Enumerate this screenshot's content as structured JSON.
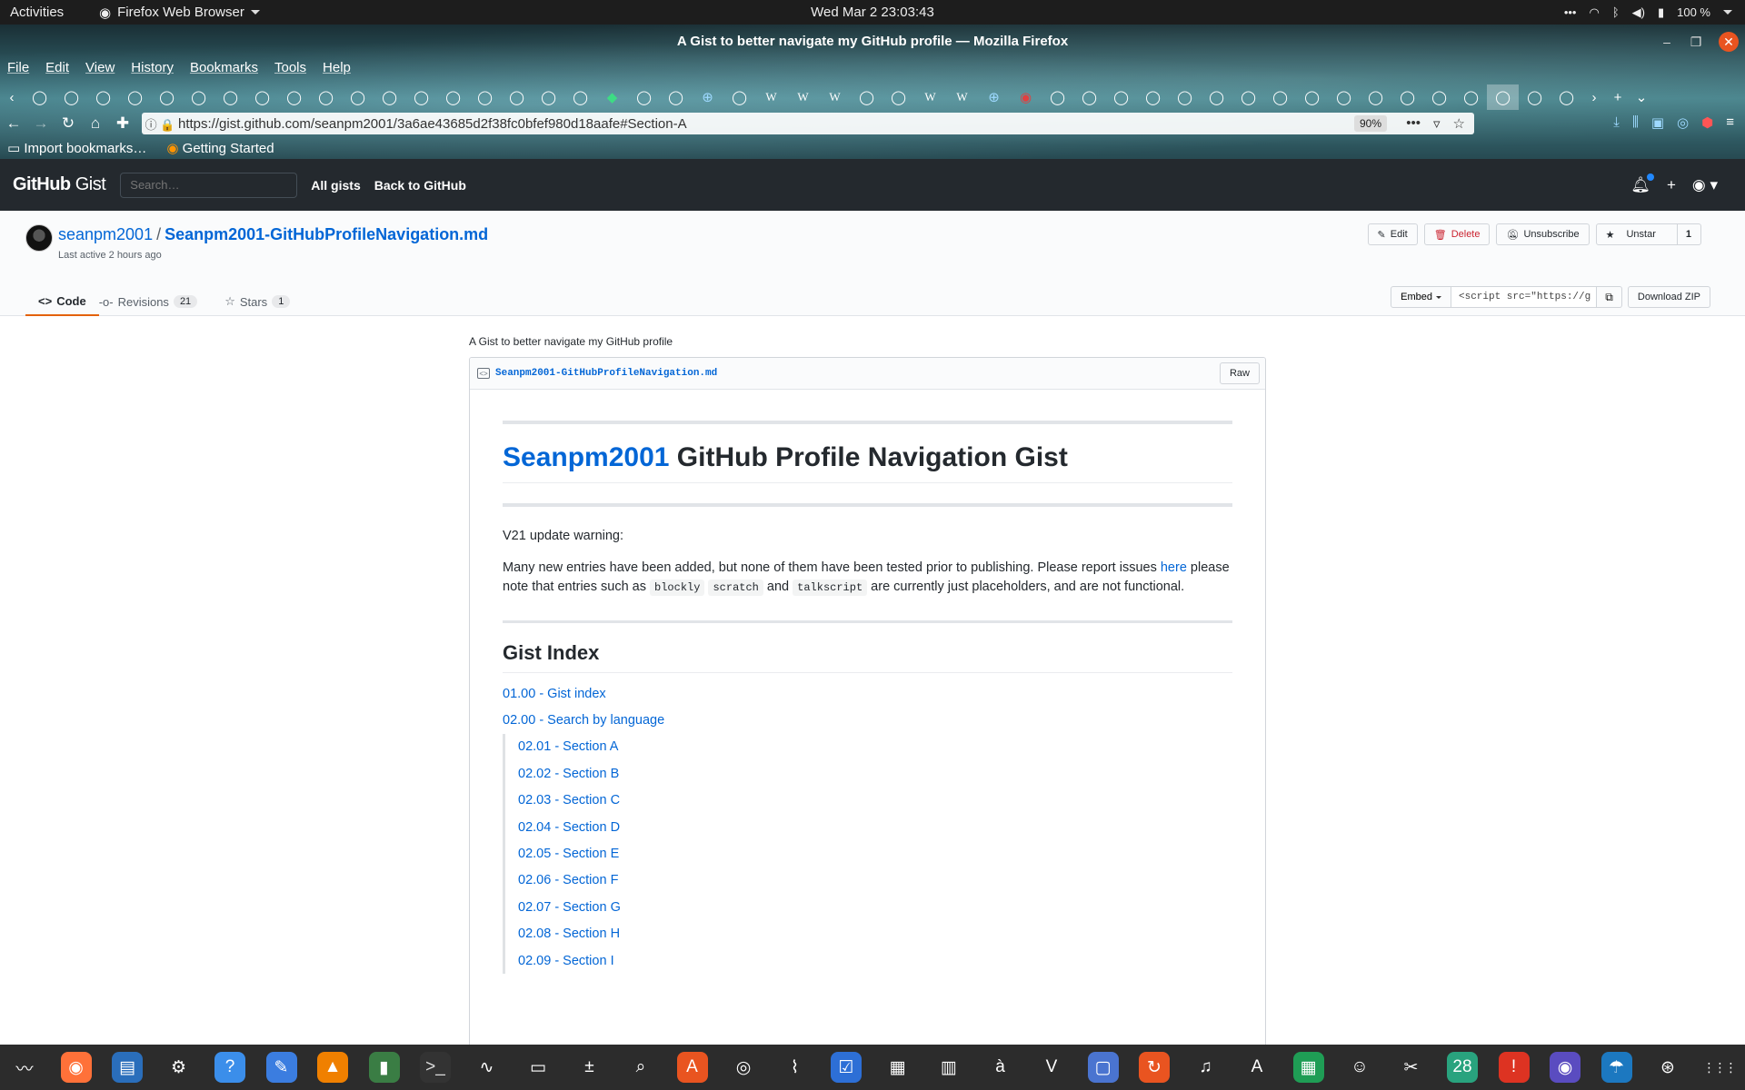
{
  "system": {
    "activities": "Activities",
    "app_name": "Firefox Web Browser",
    "clock": "Wed Mar 2  23:03:43",
    "battery": "100 %"
  },
  "window": {
    "title": "A Gist to better navigate my GitHub profile — Mozilla Firefox",
    "menu": [
      "File",
      "Edit",
      "View",
      "History",
      "Bookmarks",
      "Tools",
      "Help"
    ]
  },
  "browser": {
    "url": "https://gist.github.com/seanpm2001/3a6ae43685d2f38fc0bfef980d18aafe#Section-A",
    "zoom": "90%",
    "bookmarks": [
      "Import bookmarks…",
      "Getting Started"
    ],
    "tab_icons": [
      "github",
      "github",
      "github",
      "github",
      "github",
      "github",
      "github",
      "github",
      "github",
      "github",
      "github",
      "github",
      "github",
      "github",
      "github",
      "github",
      "github",
      "github",
      "green",
      "github",
      "github",
      "globe",
      "github",
      "wikipedia",
      "wikipedia",
      "wikipedia",
      "github",
      "github",
      "wikipedia",
      "wikipedia",
      "globe",
      "red",
      "github",
      "github",
      "github",
      "github",
      "github",
      "github",
      "github",
      "github",
      "github",
      "github",
      "github",
      "github",
      "github",
      "github",
      "github",
      "github",
      "github"
    ],
    "active_tab_index": 46
  },
  "github": {
    "logo_bold": "GitHub",
    "logo_light": " Gist",
    "search_placeholder": "Search…",
    "all_gists": "All gists",
    "back": "Back to GitHub"
  },
  "gist": {
    "owner": "seanpm2001",
    "filename_title": "Seanpm2001-GitHubProfileNavigation.md",
    "last_active": "Last active 2 hours ago",
    "actions": {
      "edit": "Edit",
      "delete": "Delete",
      "unsubscribe": "Unsubscribe",
      "unstar": "Unstar",
      "star_count": "1"
    },
    "tabs": {
      "code": "Code",
      "revisions": "Revisions",
      "revisions_count": "21",
      "stars": "Stars",
      "stars_count": "1"
    },
    "embed": {
      "label": "Embed",
      "code": "<script src=\"https://g",
      "download": "Download ZIP"
    },
    "description": "A Gist to better navigate my GitHub profile",
    "file": {
      "name": "Seanpm2001-GitHubProfileNavigation.md",
      "raw": "Raw"
    }
  },
  "markdown": {
    "h1_link": "Seanpm2001",
    "h1_rest": " GitHub Profile Navigation Gist",
    "warning_title": "V21 update warning:",
    "para_1": "Many new entries have been added, but none of them have been tested prior to publishing. Please report issues ",
    "para_link": "here",
    "para_2": " please note that entries such as ",
    "code_1": "blockly",
    "code_2": "scratch",
    "para_3": " and ",
    "code_3": "talkscript",
    "para_4": " are currently just placeholders, and are not functional.",
    "h2": "Gist Index",
    "index_top": [
      "01.00 - Gist index",
      "02.00 - Search by language"
    ],
    "index_sub": [
      "02.01 - Section A",
      "02.02 - Section B",
      "02.03 - Section C",
      "02.04 - Section D",
      "02.05 - Section E",
      "02.06 - Section F",
      "02.07 - Section G",
      "02.08 - Section H",
      "02.09 - Section I"
    ]
  },
  "dock": [
    "system-monitor",
    "firefox",
    "writer",
    "settings",
    "help",
    "text-editor",
    "vlc",
    "terminal-green",
    "terminal",
    "monitor",
    "files",
    "calculator",
    "image-viewer",
    "software",
    "disks",
    "scanner",
    "tasks",
    "screenshot",
    "archive",
    "char-map",
    "vim",
    "screencast",
    "updater",
    "music",
    "pdf",
    "spreadsheet",
    "game",
    "gimp",
    "calendar",
    "error",
    "camera",
    "weather",
    "software-updater",
    "apps-grid"
  ],
  "dock_active": 1
}
